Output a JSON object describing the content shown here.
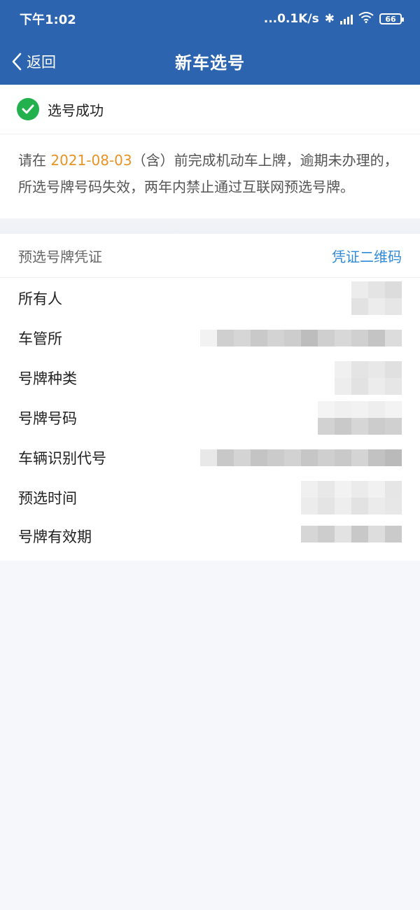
{
  "status": {
    "time": "下午1:02",
    "speed": "...0.1K/s",
    "battery": "66"
  },
  "nav": {
    "back_label": "返回",
    "title": "新车选号"
  },
  "success": {
    "label": "选号成功"
  },
  "notice": {
    "prefix": "请在 ",
    "date": "2021-08-03",
    "suffix": "（含）前完成机动车上牌，逾期未办理的，所选号牌号码失效，两年内禁止通过互联网预选号牌。"
  },
  "certificate": {
    "label": "预选号牌凭证",
    "link": "凭证二维码"
  },
  "fields": [
    {
      "label": "所有人"
    },
    {
      "label": "车管所"
    },
    {
      "label": "号牌种类"
    },
    {
      "label": "号牌号码"
    },
    {
      "label": "车辆识别代号"
    },
    {
      "label": "预选时间"
    },
    {
      "label": "号牌有效期"
    }
  ],
  "colors": {
    "header": "#2d64b0",
    "success": "#22b14c",
    "date": "#e89324",
    "link": "#2f8ad8"
  }
}
